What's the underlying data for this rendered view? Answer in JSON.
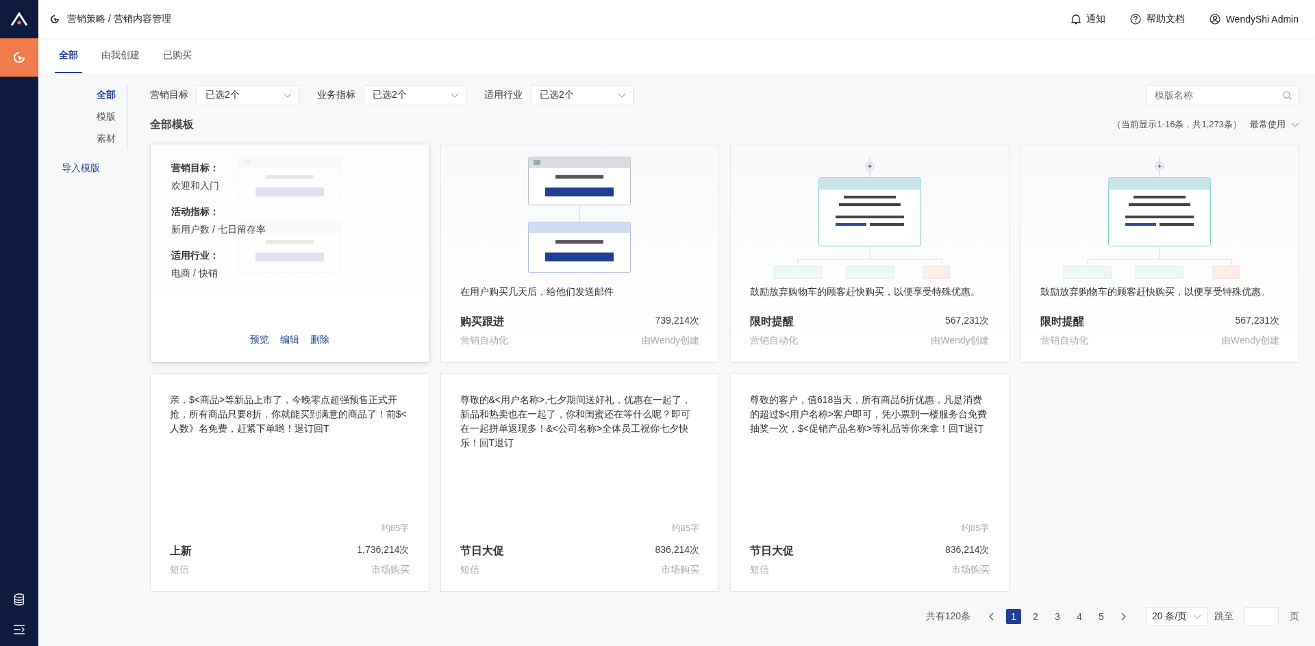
{
  "sidebar": {
    "items": [
      {
        "kind": "target",
        "selected": true
      }
    ],
    "tools": [
      {
        "kind": "database"
      },
      {
        "kind": "collapse"
      }
    ]
  },
  "header": {
    "breadcrumb": "营销策略 / 营销内容管理",
    "actions": [
      {
        "kind": "bell",
        "label": "通知"
      },
      {
        "kind": "help",
        "label": "帮助文档"
      },
      {
        "kind": "user",
        "label": "WendyShi Admin"
      }
    ]
  },
  "tabs": [
    {
      "label": "全部",
      "selected": true
    },
    {
      "label": "由我创建",
      "selected": false
    },
    {
      "label": "已购买",
      "selected": false
    }
  ],
  "subnav": {
    "items": [
      {
        "label": "全部",
        "selected": true
      },
      {
        "label": "模版",
        "selected": false
      },
      {
        "label": "素材",
        "selected": false
      }
    ],
    "link": "导入模版"
  },
  "filters": [
    {
      "label": "营销目标",
      "value": "已选2个"
    },
    {
      "label": "业务指标",
      "value": "已选2个"
    },
    {
      "label": "适用行业",
      "value": "已选2个"
    }
  ],
  "search": {
    "placeholder": "模版名称"
  },
  "section": {
    "title": "全部模板",
    "summary": "（当前显示1-16条，共1,273条）",
    "sort": "最常使用"
  },
  "cards": [
    {
      "kind": "automation",
      "preview": {
        "kind": "trigger"
      },
      "overlay": {
        "fields": [
          {
            "label": "营销目标：",
            "value": "欢迎和入门"
          },
          {
            "label": "活动指标：",
            "value": "新用户数 / 七日留存率"
          },
          {
            "label": "适用行业：",
            "value": "电商 / 快销"
          }
        ],
        "actions": [
          "预览",
          "编辑",
          "删除"
        ]
      }
    },
    {
      "kind": "automation",
      "preview": {
        "kind": "trigger"
      },
      "description": "在用户购买几天后，给他们发送邮件",
      "title": "购买跟进",
      "subtitle": "营销自动化",
      "count": "739,214次",
      "source": "由Wendy创建"
    },
    {
      "kind": "automation",
      "preview": {
        "kind": "branch"
      },
      "description": "鼓励放弃购物车的顾客赶快购买，以便享受特殊优惠。",
      "title": "限时提醒",
      "subtitle": "营销自动化",
      "count": "567,231次",
      "source": "由Wendy创建"
    },
    {
      "kind": "automation",
      "preview": {
        "kind": "branch"
      },
      "description": "鼓励放弃购物车的顾客赶快购买，以便享受特殊优惠。",
      "title": "限时提醒",
      "subtitle": "营销自动化",
      "count": "567,231次",
      "source": "由Wendy创建"
    },
    {
      "kind": "sms",
      "text": "亲，$<商品>等新品上市了，今晚零点超强预售正式开抢，所有商品只要8折，你就能买到满意的商品了！前$<人数》名免费，赶紧下单哟！退订回T",
      "length": "约85字",
      "title": "上新",
      "subtitle": "短信",
      "count": "1,736,214次",
      "source": "市场购买"
    },
    {
      "kind": "sms",
      "text": "尊敬的&<用户名称>,七夕期间送好礼，优惠在一起了，新品和热卖也在一起了，你和闺蜜还在等什么呢？即可在一起拼单返现多！&<公司名称>全体员工祝你七夕快乐！回T退订",
      "length": "约85字",
      "title": "节日大促",
      "subtitle": "短信",
      "count": "836,214次",
      "source": "市场购买"
    },
    {
      "kind": "sms",
      "text": "尊敬的客户，值618当天，所有商品6折优惠，凡是消费的超过$<用户名称>客户即可，凭小票到一楼服务台免费抽奖一次，$<促销产品名称>等礼品等你来拿！回T退订",
      "length": "约85字",
      "title": "节日大促",
      "subtitle": "短信",
      "count": "836,214次",
      "source": "市场购买"
    }
  ],
  "pagination": {
    "total": "共有120条",
    "pages": [
      {
        "label": "1",
        "selected": true
      },
      {
        "label": "2",
        "selected": false
      },
      {
        "label": "3",
        "selected": false
      },
      {
        "label": "4",
        "selected": false
      },
      {
        "label": "5",
        "selected": false
      }
    ],
    "page_size": "20 条/页",
    "jump_label": "跳至",
    "jump_suffix": "页"
  }
}
